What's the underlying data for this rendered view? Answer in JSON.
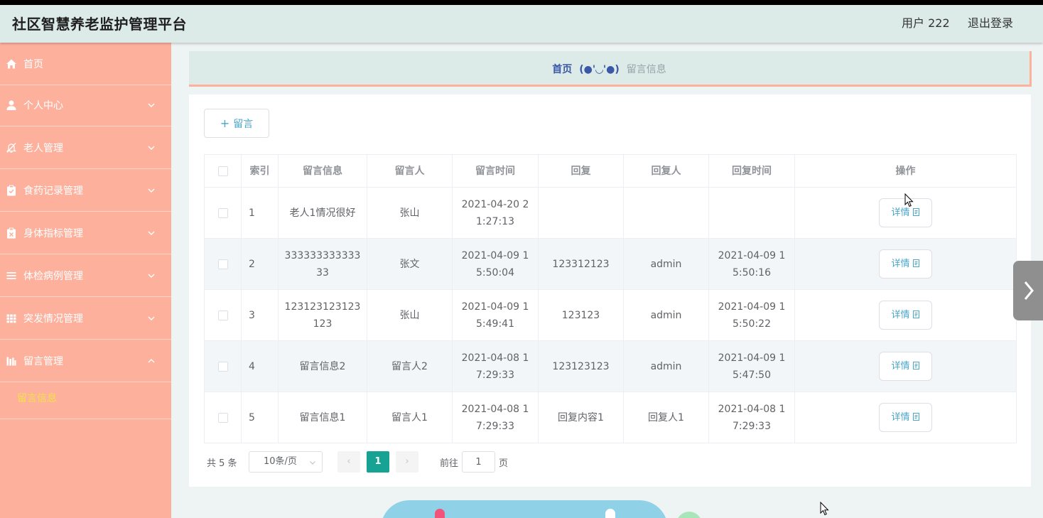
{
  "header": {
    "app_title": "社区智慧养老监护管理平台",
    "user_label": "用户 222",
    "logout_label": "退出登录"
  },
  "sidebar": {
    "items": [
      {
        "label": "首页",
        "icon": "home-icon",
        "expandable": false
      },
      {
        "label": "个人中心",
        "icon": "user-icon",
        "expandable": true
      },
      {
        "label": "老人管理",
        "icon": "bell-off-icon",
        "expandable": true
      },
      {
        "label": "食药记录管理",
        "icon": "clipboard-check-icon",
        "expandable": true
      },
      {
        "label": "身体指标管理",
        "icon": "clipboard-x-icon",
        "expandable": true
      },
      {
        "label": "体检病例管理",
        "icon": "menu-lines-icon",
        "expandable": true
      },
      {
        "label": "突发情况管理",
        "icon": "grid-icon",
        "expandable": true
      },
      {
        "label": "留言管理",
        "icon": "bar-chart-icon",
        "expandable": true,
        "expanded": true
      }
    ],
    "subitem": "留言信息"
  },
  "breadcrumb": {
    "home": "首页",
    "separator": "(●'◡'●)",
    "current": "留言信息"
  },
  "toolbar": {
    "add_label": "留言"
  },
  "table": {
    "headers": [
      "索引",
      "留言信息",
      "留言人",
      "留言时间",
      "回复",
      "回复人",
      "回复时间",
      "操作"
    ],
    "rows": [
      {
        "index": "1",
        "message": "老人1情况很好",
        "author": "张山",
        "time": "2021-04-20 21:27:13",
        "reply": "",
        "replier": "",
        "reply_time": ""
      },
      {
        "index": "2",
        "message": "33333333333333",
        "author": "张文",
        "time": "2021-04-09 15:50:04",
        "reply": "123312123",
        "replier": "admin",
        "reply_time": "2021-04-09 15:50:16"
      },
      {
        "index": "3",
        "message": "123123123123123",
        "author": "张山",
        "time": "2021-04-09 15:49:41",
        "reply": "123123",
        "replier": "admin",
        "reply_time": "2021-04-09 15:50:22"
      },
      {
        "index": "4",
        "message": "留言信息2",
        "author": "留言人2",
        "time": "2021-04-08 17:29:33",
        "reply": "123123123",
        "replier": "admin",
        "reply_time": "2021-04-09 15:47:50"
      },
      {
        "index": "5",
        "message": "留言信息1",
        "author": "留言人1",
        "time": "2021-04-08 17:29:33",
        "reply": "回复内容1",
        "replier": "回复人1",
        "reply_time": "2021-04-08 17:29:33"
      }
    ],
    "detail_label": "详情"
  },
  "pagination": {
    "total": "共 5 条",
    "page_size": "10条/页",
    "current_page": "1",
    "goto_label": "前往",
    "goto_value": "1",
    "page_unit": "页"
  },
  "colors": {
    "sidebar": "#fdb19d",
    "header": "#dcebe7",
    "accent": "#16a394",
    "link": "#49a6c9",
    "active_submenu": "#f5e04a"
  }
}
